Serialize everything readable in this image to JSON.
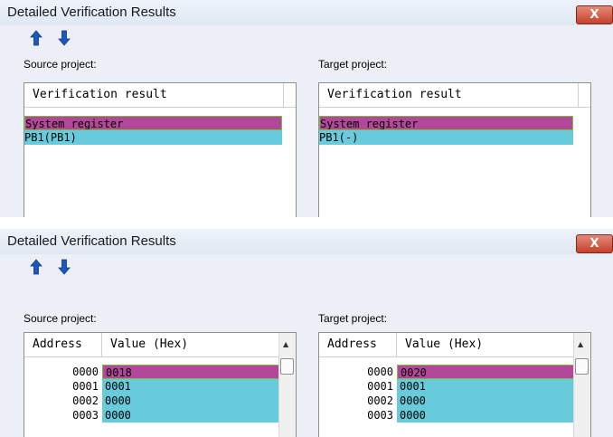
{
  "window1": {
    "title": "Detailed Verification Results",
    "close_label": "X",
    "source_label": "Source project:",
    "target_label": "Target project:",
    "source": {
      "header": "Verification result",
      "rows": [
        "System register",
        "PB1(PB1)"
      ]
    },
    "target": {
      "header": "Verification result",
      "rows": [
        "System register",
        "PB1(-)"
      ]
    }
  },
  "window2": {
    "title": "Detailed Verification Results",
    "close_label": "X",
    "source_label": "Source project:",
    "target_label": "Target project:",
    "source": {
      "col_address": "Address",
      "col_value": "Value (Hex)",
      "rows": [
        {
          "address": "0000",
          "value": "0018"
        },
        {
          "address": "0001",
          "value": "0001"
        },
        {
          "address": "0002",
          "value": "0000"
        },
        {
          "address": "0003",
          "value": "0000"
        }
      ]
    },
    "target": {
      "col_address": "Address",
      "col_value": "Value (Hex)",
      "rows": [
        {
          "address": "0000",
          "value": "0020"
        },
        {
          "address": "0001",
          "value": "0001"
        },
        {
          "address": "0002",
          "value": "0000"
        },
        {
          "address": "0003",
          "value": "0000"
        }
      ]
    }
  },
  "icons": [
    "up-arrow-icon",
    "down-arrow-icon",
    "close-icon",
    "scroll-up-icon"
  ],
  "colors": {
    "mismatch_row": "#b3479a",
    "match_row": "#67cbdb",
    "close_button": "#c4412b",
    "arrow_icon": "#1f57b8"
  }
}
